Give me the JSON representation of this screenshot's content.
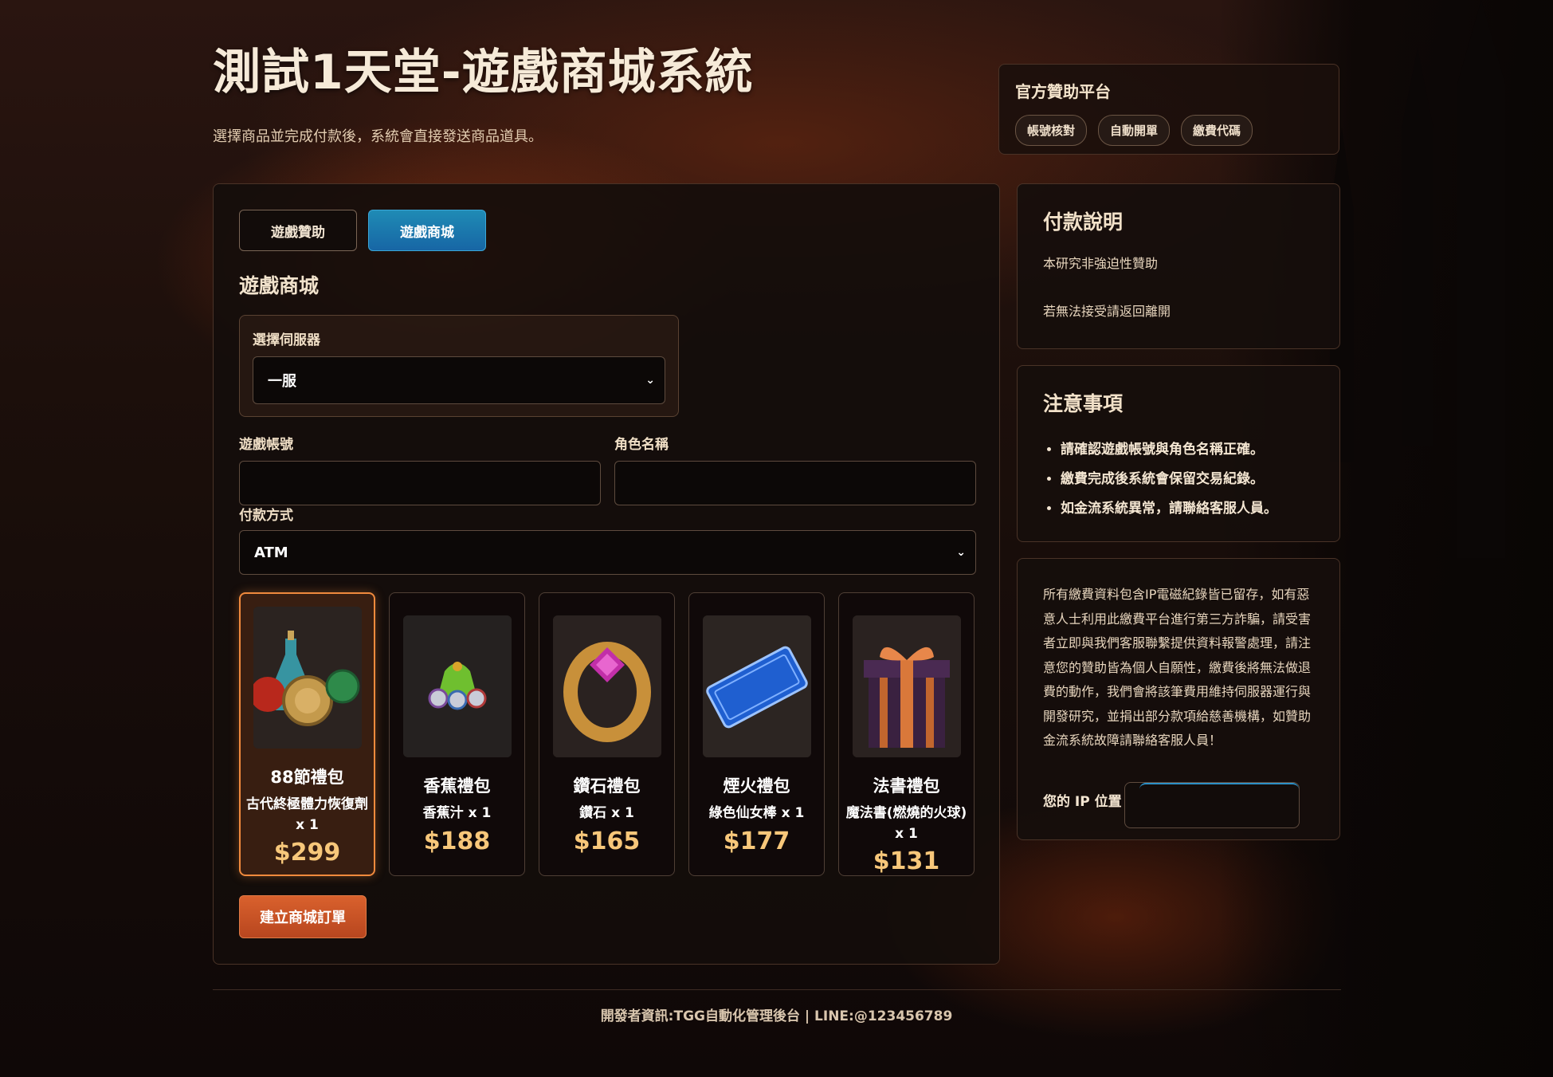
{
  "header": {
    "title": "測試1天堂-遊戲商城系統",
    "subtitle": "選擇商品並完成付款後，系統會直接發送商品道具。"
  },
  "sponsor": {
    "title": "官方贊助平台",
    "pills": [
      "帳號核對",
      "自動開單",
      "繳費代碼"
    ]
  },
  "tabs": [
    {
      "label": "遊戲贊助",
      "active": false
    },
    {
      "label": "遊戲商城",
      "active": true
    }
  ],
  "section_title": "遊戲商城",
  "server": {
    "label": "選擇伺服器",
    "value": "一服"
  },
  "account": {
    "label": "遊戲帳號",
    "value": ""
  },
  "role": {
    "label": "角色名稱",
    "value": ""
  },
  "payment": {
    "label": "付款方式",
    "value": "ATM"
  },
  "products": [
    {
      "name": "88節禮包",
      "item": "古代終極體力恢復劑 x 1",
      "price": "$299",
      "selected": true,
      "icon": "potion-bundle-icon"
    },
    {
      "name": "香蕉禮包",
      "item": "香蕉汁 x 1",
      "price": "$188",
      "selected": false,
      "icon": "gem-bag-icon"
    },
    {
      "name": "鑽石禮包",
      "item": "鑽石 x 1",
      "price": "$165",
      "selected": false,
      "icon": "diamond-ring-icon"
    },
    {
      "name": "煙火禮包",
      "item": "綠色仙女棒 x 1",
      "price": "$177",
      "selected": false,
      "icon": "season-pass-ticket-icon"
    },
    {
      "name": "法書禮包",
      "item": "魔法書(燃燒的火球) x 1",
      "price": "$131",
      "selected": false,
      "icon": "gift-box-icon"
    }
  ],
  "order_button": "建立商城訂單",
  "pay_info": {
    "title": "付款說明",
    "lines": [
      "本研究非強迫性贊助",
      "若無法接受請返回離開"
    ]
  },
  "notes": {
    "title": "注意事項",
    "items": [
      "請確認遊戲帳號與角色名稱正確。",
      "繳費完成後系統會保留交易紀錄。",
      "如金流系統異常，請聯絡客服人員。"
    ]
  },
  "disclaimer": {
    "text": "所有繳費資料包含IP電磁紀錄皆已留存，如有惡意人士利用此繳費平台進行第三方詐騙，請受害者立即與我們客服聯繫提供資料報警處理，請注意您的贊助皆為個人自願性，繳費後將無法做退費的動作，我們會將該筆費用維持伺服器運行與開發研究，並捐出部分款項給慈善機構，如贊助金流系統故障請聯絡客服人員！",
    "ip_label": "您的 IP 位置"
  },
  "footer": "開發者資訊:TGG自動化管理後台 | LINE:@123456789",
  "colors": {
    "accent": "#f08a3d",
    "tab_active": "#1f8bb5",
    "price": "#f7c77a",
    "order_button": "#d9612d"
  }
}
